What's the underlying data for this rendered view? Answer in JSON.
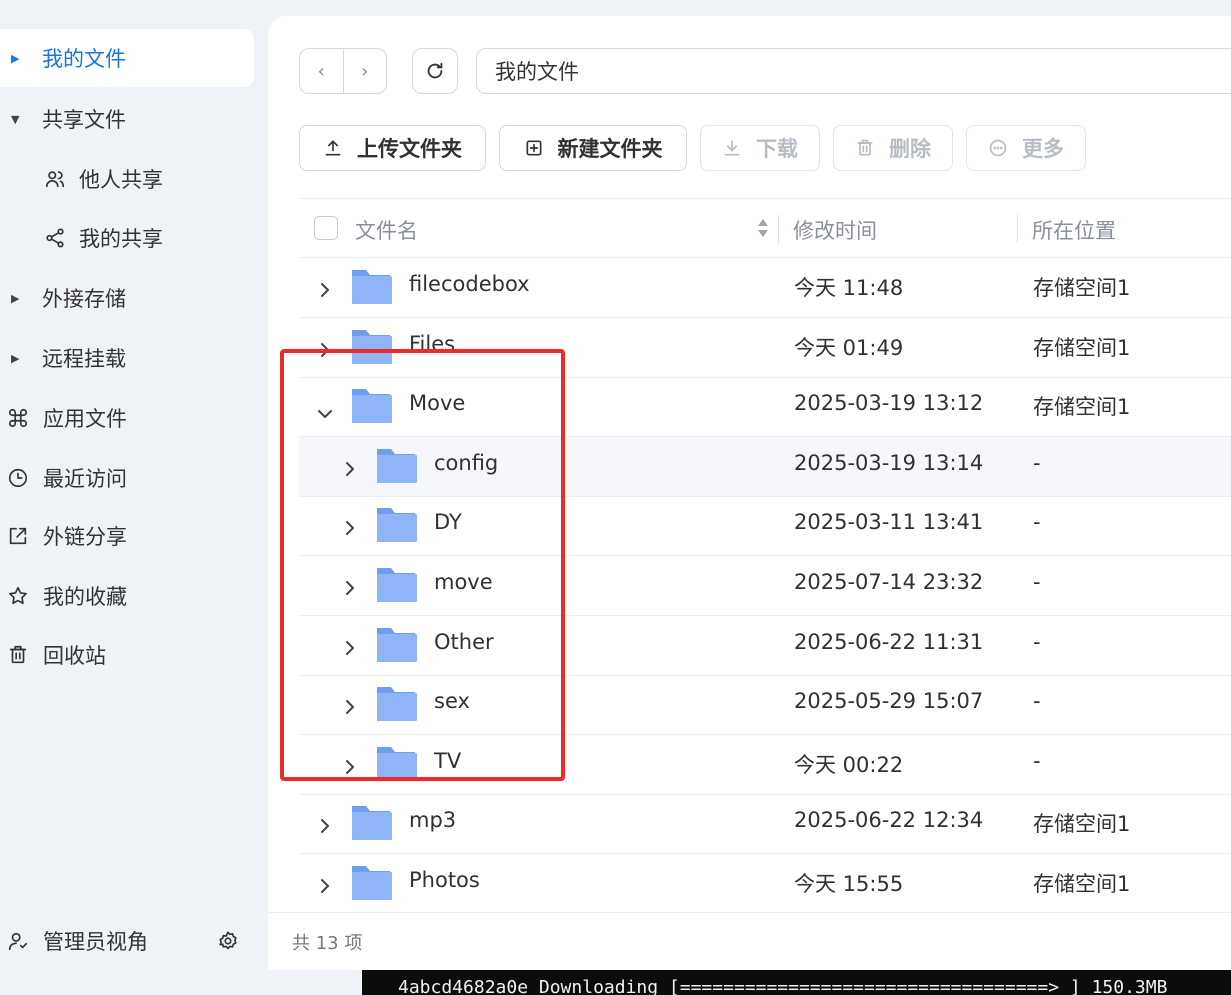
{
  "sidebar": {
    "items": [
      {
        "label": "我的文件",
        "active": true,
        "kind": "arrow-right"
      },
      {
        "label": "共享文件",
        "kind": "arrow-down"
      },
      {
        "label": "他人共享",
        "kind": "sub",
        "icon": "users-icon"
      },
      {
        "label": "我的共享",
        "kind": "sub",
        "icon": "share-icon"
      },
      {
        "label": "外接存储",
        "kind": "arrow-right"
      },
      {
        "label": "远程挂载",
        "kind": "arrow-right"
      },
      {
        "label": "应用文件",
        "kind": "icon",
        "icon": "command-icon"
      },
      {
        "label": "最近访问",
        "kind": "icon",
        "icon": "clock-icon"
      },
      {
        "label": "外链分享",
        "kind": "icon",
        "icon": "external-share-icon"
      },
      {
        "label": "我的收藏",
        "kind": "icon",
        "icon": "star-icon"
      },
      {
        "label": "回收站",
        "kind": "icon",
        "icon": "trash-icon"
      }
    ],
    "admin_label": "管理员视角"
  },
  "toolbar": {
    "path": "我的文件",
    "upload_label": "上传文件夹",
    "new_folder_label": "新建文件夹",
    "download_label": "下载",
    "delete_label": "删除",
    "more_label": "更多"
  },
  "table": {
    "columns": {
      "name": "文件名",
      "time": "修改时间",
      "location": "所在位置"
    },
    "rows": [
      {
        "name": "filecodebox",
        "time": "今天 11:48",
        "location": "存储空间1",
        "level": 0,
        "expanded": false
      },
      {
        "name": "Files",
        "time": "今天 01:49",
        "location": "存储空间1",
        "level": 0,
        "expanded": false
      },
      {
        "name": "Move",
        "time": "2025-03-19 13:12",
        "location": "存储空间1",
        "level": 0,
        "expanded": true
      },
      {
        "name": "config",
        "time": "2025-03-19 13:14",
        "location": "-",
        "level": 1,
        "expanded": false,
        "highlight": true
      },
      {
        "name": "DY",
        "time": "2025-03-11 13:41",
        "location": "-",
        "level": 1,
        "expanded": false
      },
      {
        "name": "move",
        "time": "2025-07-14 23:32",
        "location": "-",
        "level": 1,
        "expanded": false
      },
      {
        "name": "Other",
        "time": "2025-06-22 11:31",
        "location": "-",
        "level": 1,
        "expanded": false
      },
      {
        "name": "sex",
        "time": "2025-05-29 15:07",
        "location": "-",
        "level": 1,
        "expanded": false
      },
      {
        "name": "TV",
        "time": "今天 00:22",
        "location": "-",
        "level": 1,
        "expanded": false
      },
      {
        "name": "mp3",
        "time": "2025-06-22 12:34",
        "location": "存储空间1",
        "level": 0,
        "expanded": false
      },
      {
        "name": "Photos",
        "time": "今天 15:55",
        "location": "存储空间1",
        "level": 0,
        "expanded": false
      }
    ]
  },
  "footer": {
    "count_text": "共 13 项"
  },
  "terminal": {
    "line": "4abcd4682a0e Downloading [==================================>  ] 150.3MB"
  },
  "colors": {
    "accent": "#1a73e8",
    "annotation": "#ee2b2b",
    "folder": "#8fb5f8"
  }
}
